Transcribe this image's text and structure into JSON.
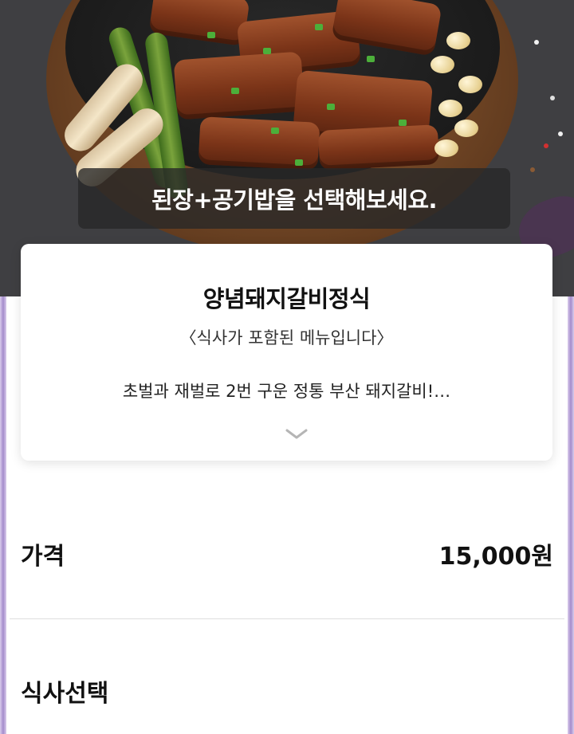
{
  "hero": {
    "caption": "된장+공기밥을 선택해보세요."
  },
  "menu": {
    "title": "양념돼지갈비정식",
    "subtitle": "〈식사가 포함된 메뉴입니다〉",
    "description": "초벌과 재벌로 2번 구운 정통 부산 돼지갈비!…",
    "expand_icon": "chevron-down-icon"
  },
  "price": {
    "label": "가격",
    "value": "15,000원"
  },
  "meal_select": {
    "label": "식사선택"
  },
  "colors": {
    "frame_accent": "#7e5bb5",
    "caption_bg": "#282828",
    "divider": "#dedede"
  }
}
